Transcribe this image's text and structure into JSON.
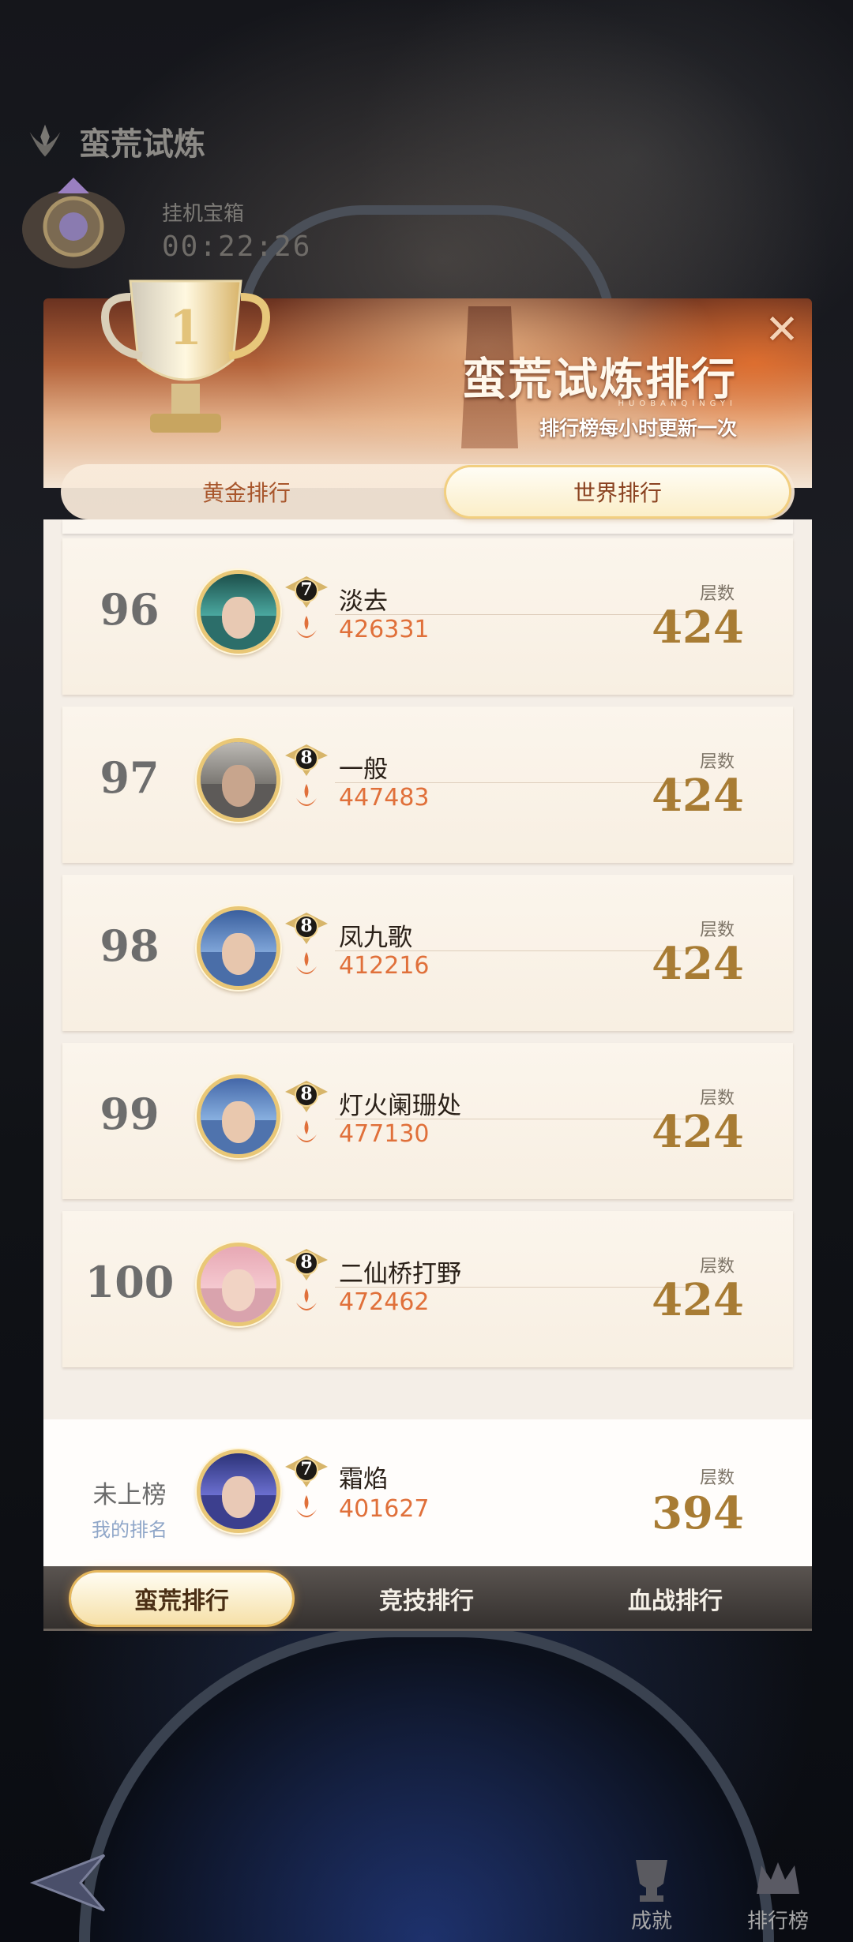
{
  "hud": {
    "title": "蛮荒试炼",
    "chest_label": "挂机宝箱",
    "chest_timer": "00:22:26"
  },
  "modal": {
    "title": "蛮荒试炼排行",
    "pinyin": "HUOBANQINGYI",
    "subtitle": "排行榜每小时更新一次",
    "close_icon": "close-icon",
    "tabs": [
      {
        "label": "黄金排行",
        "selected": false
      },
      {
        "label": "世界排行",
        "selected": true
      }
    ]
  },
  "rows": [
    {
      "rank": "96",
      "level": "7",
      "name": "淡去",
      "id": "426331",
      "floors_label": "层数",
      "floors": "424"
    },
    {
      "rank": "97",
      "level": "8",
      "name": "一般",
      "id": "447483",
      "floors_label": "层数",
      "floors": "424"
    },
    {
      "rank": "98",
      "level": "8",
      "name": "凤九歌",
      "id": "412216",
      "floors_label": "层数",
      "floors": "424"
    },
    {
      "rank": "99",
      "level": "8",
      "name": "灯火阑珊处",
      "id": "477130",
      "floors_label": "层数",
      "floors": "424"
    },
    {
      "rank": "100",
      "level": "8",
      "name": "二仙桥打野",
      "id": "472462",
      "floors_label": "层数",
      "floors": "424"
    }
  ],
  "my_rank": {
    "status": "未上榜",
    "label": "我的排名",
    "level": "7",
    "name": "霜焰",
    "id": "401627",
    "floors_label": "层数",
    "floors": "394"
  },
  "bottom_tabs": [
    {
      "label": "蛮荒排行",
      "selected": true
    },
    {
      "label": "竞技排行",
      "selected": false
    },
    {
      "label": "血战排行",
      "selected": false
    }
  ],
  "corner": {
    "achievements": "成就",
    "leaderboard": "排行榜"
  },
  "colors": {
    "id_orange": "#e0703a",
    "floors_gold": "#a87c34",
    "tab_text": "#a8562c"
  }
}
